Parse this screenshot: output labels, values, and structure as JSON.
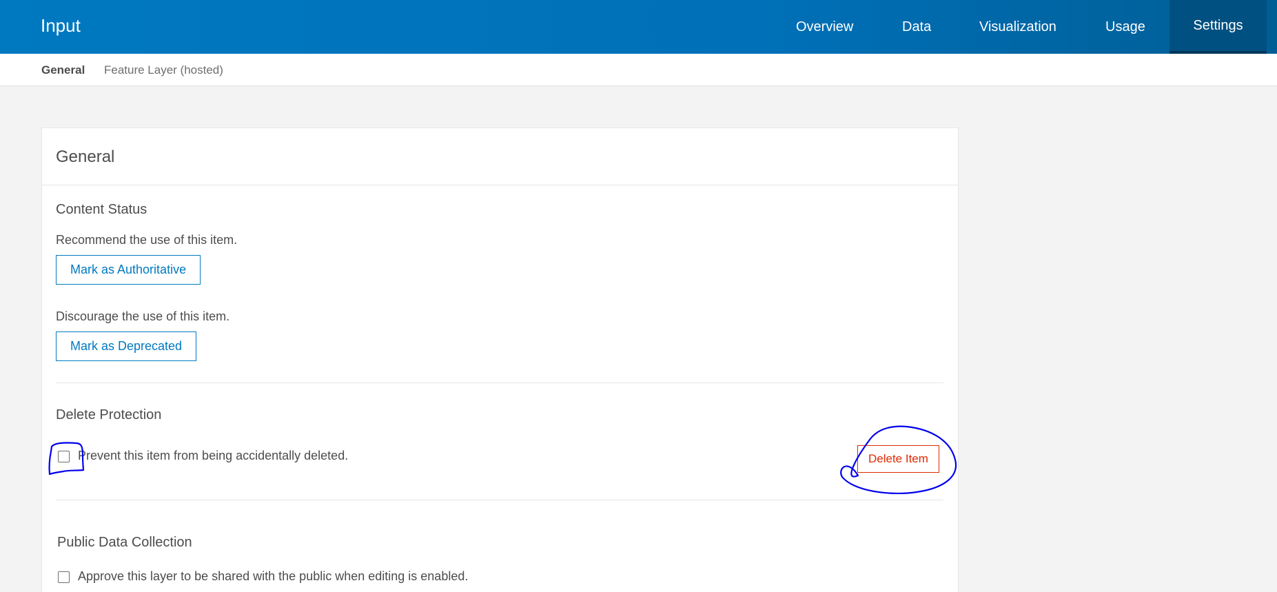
{
  "header": {
    "title": "Input",
    "nav": [
      {
        "label": "Overview"
      },
      {
        "label": "Data"
      },
      {
        "label": "Visualization"
      },
      {
        "label": "Usage"
      },
      {
        "label": "Settings"
      }
    ],
    "active_nav": "Settings"
  },
  "subnav": {
    "items": [
      {
        "label": "General"
      },
      {
        "label": "Feature Layer (hosted)"
      }
    ],
    "active": "General"
  },
  "card": {
    "title": "General",
    "content_status": {
      "title": "Content Status",
      "recommend_text": "Recommend the use of this item.",
      "authoritative_button": "Mark as Authoritative",
      "discourage_text": "Discourage the use of this item.",
      "deprecated_button": "Mark as Deprecated"
    },
    "delete_protection": {
      "title": "Delete Protection",
      "checkbox_label": "Prevent this item from being accidentally deleted.",
      "checked": false,
      "delete_button": "Delete Item"
    },
    "public_data_collection": {
      "title": "Public Data Collection",
      "checkbox_label": "Approve this layer to be shared with the public when editing is enabled.",
      "checked": false
    }
  },
  "colors": {
    "brand_blue": "#0079c1",
    "danger": "#de2900",
    "annotation_ink": "#0000ee"
  }
}
